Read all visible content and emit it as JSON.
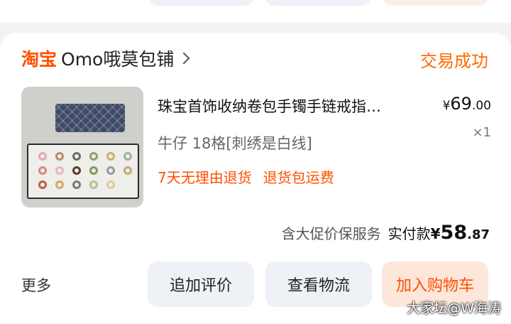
{
  "shop": {
    "logo_text": "淘宝",
    "name": "Omo哦莫包铺",
    "status": "交易成功"
  },
  "product": {
    "title": "珠宝首饰收纳卷包手镯手链戒指…",
    "price_currency": "¥",
    "price_int": "69",
    "price_dec": ".00",
    "sku": "牛仔  18格[刺绣是白线]",
    "quantity": "×1",
    "services": [
      "7天无理由退货",
      "退货包运费"
    ]
  },
  "payment": {
    "note": "含大促价保服务",
    "label": "实付款",
    "currency": "¥",
    "int": "58",
    "dec": ".87"
  },
  "actions": {
    "more_label": "更多",
    "review_label": "追加评价",
    "logistics_label": "查看物流",
    "cart_label": "加入购物车"
  },
  "watermark": "大家坛@W海涛",
  "colors": {
    "brand": "#ff5000",
    "status": "#ff6a00",
    "button_gray": "#eef1f6",
    "button_orange_bg": "#fde6da"
  },
  "icons": [
    "chevron-right-icon"
  ]
}
